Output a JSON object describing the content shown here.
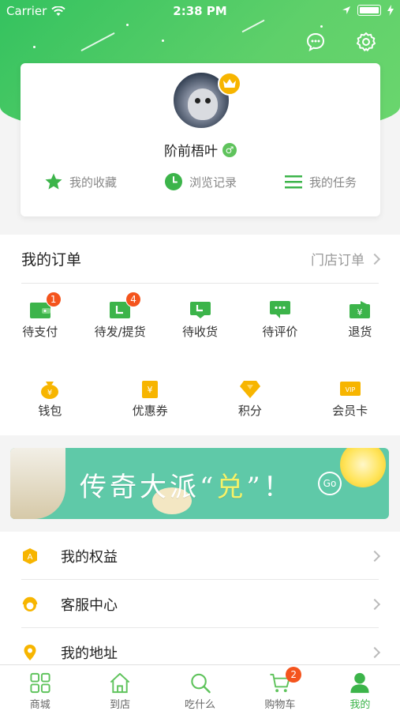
{
  "status_bar": {
    "carrier": "Carrier",
    "time": "2:38 PM"
  },
  "header": {
    "chat_icon": "chat-bubble-icon",
    "settings_icon": "gear-icon"
  },
  "profile": {
    "username": "阶前梧叶",
    "gender_symbol": "♂",
    "quick_links": [
      {
        "label": "我的收藏",
        "icon": "star-icon"
      },
      {
        "label": "浏览记录",
        "icon": "clock-icon"
      },
      {
        "label": "我的任务",
        "icon": "list-icon"
      }
    ]
  },
  "orders": {
    "title": "我的订单",
    "store_orders_link": "门店订单",
    "status_items": [
      {
        "label": "待支付",
        "badge": "1"
      },
      {
        "label": "待发/提货",
        "badge": "4"
      },
      {
        "label": "待收货",
        "badge": ""
      },
      {
        "label": "待评价",
        "badge": ""
      },
      {
        "label": "退货",
        "badge": ""
      }
    ],
    "asset_items": [
      {
        "label": "钱包",
        "icon": "money-bag-icon"
      },
      {
        "label": "优惠券",
        "icon": "coupon-icon"
      },
      {
        "label": "积分",
        "icon": "points-gem-icon"
      },
      {
        "label": "会员卡",
        "icon": "vip-card-icon"
      }
    ]
  },
  "banner": {
    "text_before": "传奇大派“",
    "text_highlight": "兑",
    "text_after": "”！",
    "go_label": "Go"
  },
  "menu": [
    {
      "label": "我的权益",
      "icon": "rights-shield-icon"
    },
    {
      "label": "客服中心",
      "icon": "headset-icon"
    },
    {
      "label": "我的地址",
      "icon": "location-pin-icon"
    }
  ],
  "tabbar": {
    "items": [
      {
        "label": "商城",
        "icon": "grid-icon"
      },
      {
        "label": "到店",
        "icon": "store-icon"
      },
      {
        "label": "吃什么",
        "icon": "search-icon"
      },
      {
        "label": "购物车",
        "icon": "cart-icon",
        "badge": "2"
      },
      {
        "label": "我的",
        "icon": "user-icon",
        "active": true
      }
    ]
  },
  "colors": {
    "brand_green": "#3cb44a",
    "badge_orange": "#f4541d",
    "accent_yellow": "#f7b500"
  }
}
